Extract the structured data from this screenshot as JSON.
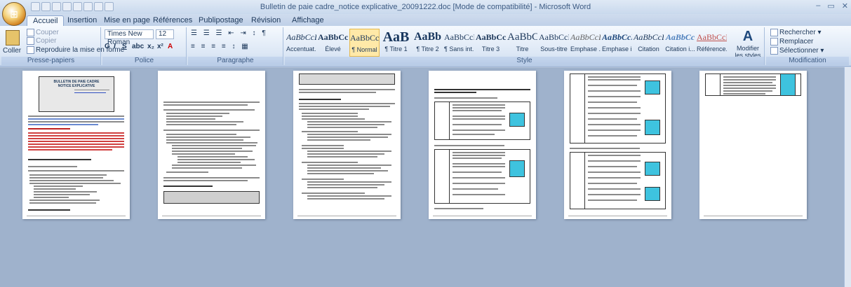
{
  "window": {
    "title": "Bulletin de paie cadre_notice explicative_20091222.doc [Mode de compatibilité] - Microsoft Word"
  },
  "tabs": [
    "Accueil",
    "Insertion",
    "Mise en page",
    "Références",
    "Publipostage",
    "Révision",
    "Affichage"
  ],
  "clipboard": {
    "paste": "Coller",
    "cut": "Couper",
    "copy": "Copier",
    "format_painter": "Reproduire la mise en forme",
    "label": "Presse-papiers"
  },
  "font": {
    "name": "Times New Roman",
    "size": "12",
    "label": "Police"
  },
  "paragraph": {
    "label": "Paragraphe"
  },
  "styles": {
    "label": "Style",
    "items": [
      {
        "sample": "AaBbCcD",
        "name": "Accentuat..."
      },
      {
        "sample": "AaBbCcD",
        "name": "Élevé"
      },
      {
        "sample": "AaBbCcI",
        "name": "¶ Normal"
      },
      {
        "sample": "AaB",
        "name": "¶ Titre 1"
      },
      {
        "sample": "AaBb",
        "name": "¶ Titre 2"
      },
      {
        "sample": "AaBbCcI",
        "name": "¶ Sans int..."
      },
      {
        "sample": "AaBbCcI",
        "name": "Titre 3"
      },
      {
        "sample": "AaBbC",
        "name": "Titre"
      },
      {
        "sample": "AaBbCcI",
        "name": "Sous-titre"
      },
      {
        "sample": "AaBbCcD",
        "name": "Emphase ..."
      },
      {
        "sample": "AaBbCcD",
        "name": "Emphase i..."
      },
      {
        "sample": "AaBbCcL",
        "name": "Citation"
      },
      {
        "sample": "AaBbCc",
        "name": "Citation i..."
      },
      {
        "sample": "AaBbCcD",
        "name": "Référence..."
      }
    ],
    "change": "Modifier les styles"
  },
  "editing": {
    "find": "Rechercher",
    "replace": "Remplacer",
    "select": "Sélectionner",
    "label": "Modification"
  },
  "pages": {
    "p1_title": "BULLETIN DE PAIE CADRE",
    "p1_subtitle": "NOTICE EXPLICATIVE"
  }
}
